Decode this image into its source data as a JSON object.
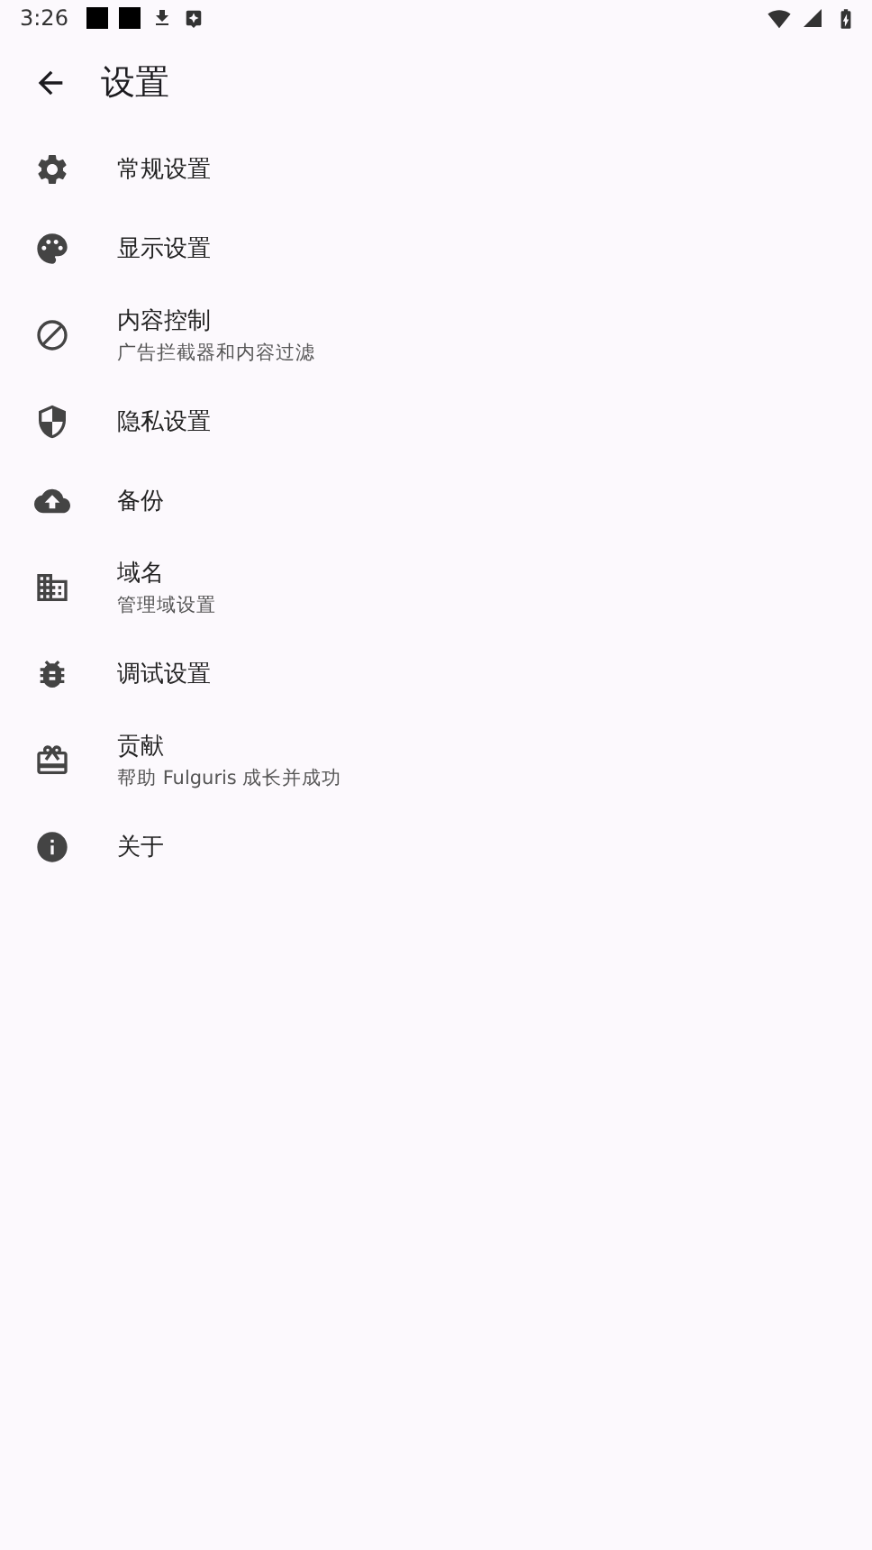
{
  "status_bar": {
    "time": "3:26"
  },
  "app_bar": {
    "title": "设置"
  },
  "items": [
    {
      "title": "常规设置"
    },
    {
      "title": "显示设置"
    },
    {
      "title": "内容控制",
      "subtitle": "广告拦截器和内容过滤"
    },
    {
      "title": "隐私设置"
    },
    {
      "title": "备份"
    },
    {
      "title": "域名",
      "subtitle": "管理域设置"
    },
    {
      "title": "调试设置"
    },
    {
      "title": "贡献",
      "subtitle": "帮助 Fulguris 成长并成功"
    },
    {
      "title": "关于"
    }
  ]
}
